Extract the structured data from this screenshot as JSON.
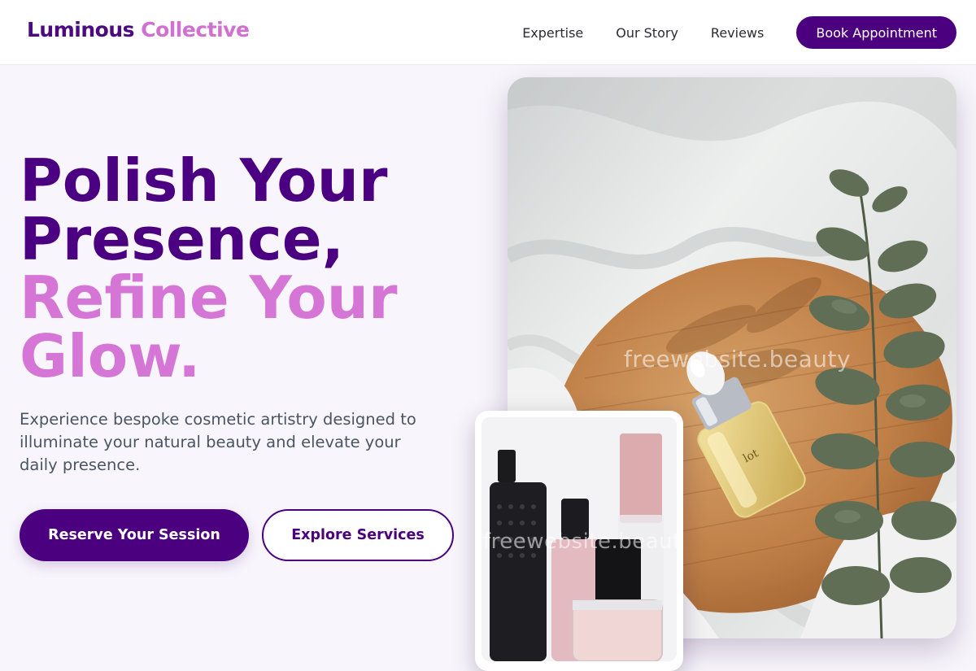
{
  "header": {
    "logo_primary": "Luminous",
    "logo_accent": "Collective",
    "nav": [
      "Expertise",
      "Our Story",
      "Reviews"
    ],
    "cta_label": "Book Appointment"
  },
  "hero": {
    "headline_line1": "Polish Your",
    "headline_line2": "Presence,",
    "headline_line3": "Refine Your",
    "headline_line4": "Glow.",
    "subtitle": "Experience bespoke cosmetic artistry designed to illuminate your natural beauty and elevate your daily presence.",
    "primary_button": "Reserve Your Session",
    "secondary_button": "Explore Services"
  },
  "images": {
    "main_watermark": "freewebsite.beauty",
    "inset_watermark": "freewebsite.beauty"
  },
  "colors": {
    "brand_dark": "#4b0080",
    "brand_accent": "#d575d6",
    "body_text": "#4a5563",
    "page_bg": "#f8f6fc"
  }
}
